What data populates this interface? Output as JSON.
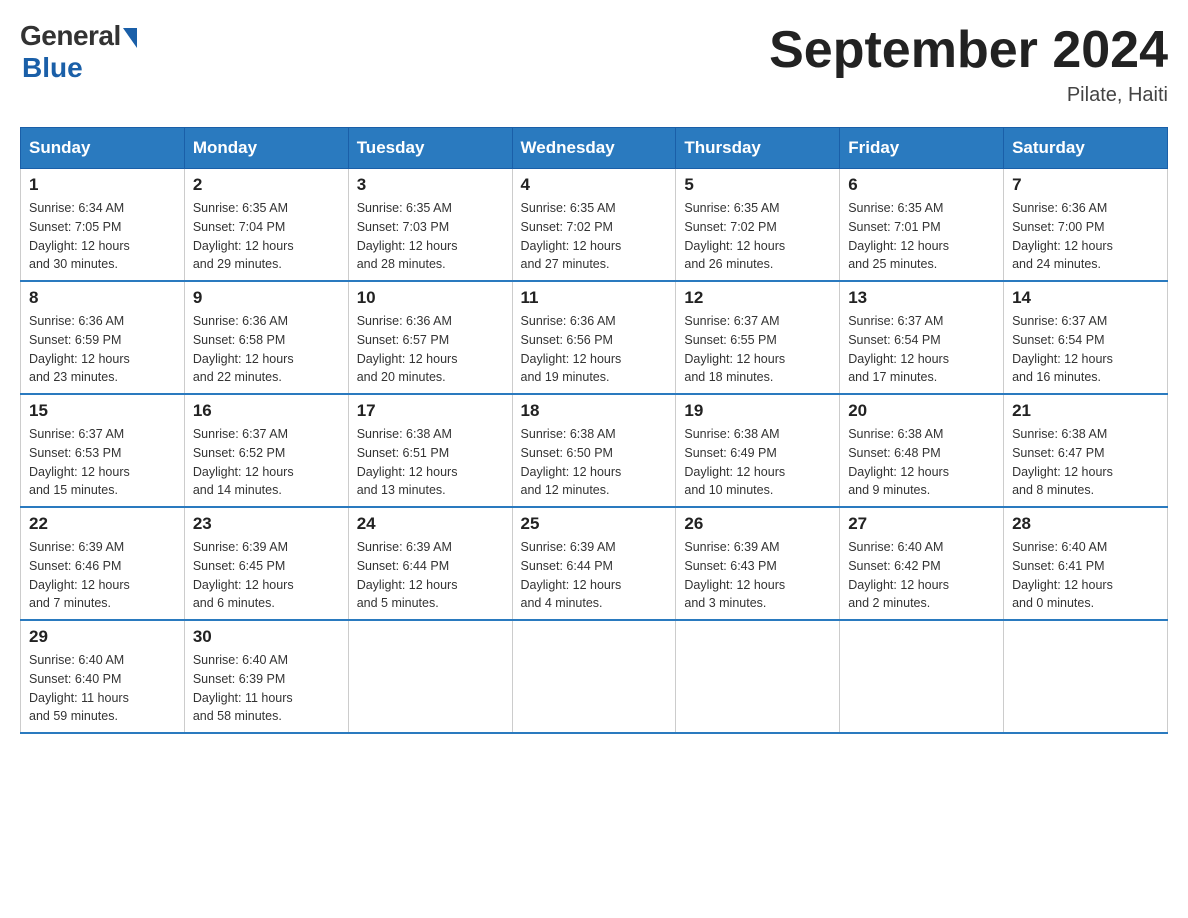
{
  "header": {
    "logo_general": "General",
    "logo_blue": "Blue",
    "month_title": "September 2024",
    "location": "Pilate, Haiti"
  },
  "weekdays": [
    "Sunday",
    "Monday",
    "Tuesday",
    "Wednesday",
    "Thursday",
    "Friday",
    "Saturday"
  ],
  "weeks": [
    [
      {
        "day": "1",
        "sunrise": "6:34 AM",
        "sunset": "7:05 PM",
        "daylight": "12 hours and 30 minutes."
      },
      {
        "day": "2",
        "sunrise": "6:35 AM",
        "sunset": "7:04 PM",
        "daylight": "12 hours and 29 minutes."
      },
      {
        "day": "3",
        "sunrise": "6:35 AM",
        "sunset": "7:03 PM",
        "daylight": "12 hours and 28 minutes."
      },
      {
        "day": "4",
        "sunrise": "6:35 AM",
        "sunset": "7:02 PM",
        "daylight": "12 hours and 27 minutes."
      },
      {
        "day": "5",
        "sunrise": "6:35 AM",
        "sunset": "7:02 PM",
        "daylight": "12 hours and 26 minutes."
      },
      {
        "day": "6",
        "sunrise": "6:35 AM",
        "sunset": "7:01 PM",
        "daylight": "12 hours and 25 minutes."
      },
      {
        "day": "7",
        "sunrise": "6:36 AM",
        "sunset": "7:00 PM",
        "daylight": "12 hours and 24 minutes."
      }
    ],
    [
      {
        "day": "8",
        "sunrise": "6:36 AM",
        "sunset": "6:59 PM",
        "daylight": "12 hours and 23 minutes."
      },
      {
        "day": "9",
        "sunrise": "6:36 AM",
        "sunset": "6:58 PM",
        "daylight": "12 hours and 22 minutes."
      },
      {
        "day": "10",
        "sunrise": "6:36 AM",
        "sunset": "6:57 PM",
        "daylight": "12 hours and 20 minutes."
      },
      {
        "day": "11",
        "sunrise": "6:36 AM",
        "sunset": "6:56 PM",
        "daylight": "12 hours and 19 minutes."
      },
      {
        "day": "12",
        "sunrise": "6:37 AM",
        "sunset": "6:55 PM",
        "daylight": "12 hours and 18 minutes."
      },
      {
        "day": "13",
        "sunrise": "6:37 AM",
        "sunset": "6:54 PM",
        "daylight": "12 hours and 17 minutes."
      },
      {
        "day": "14",
        "sunrise": "6:37 AM",
        "sunset": "6:54 PM",
        "daylight": "12 hours and 16 minutes."
      }
    ],
    [
      {
        "day": "15",
        "sunrise": "6:37 AM",
        "sunset": "6:53 PM",
        "daylight": "12 hours and 15 minutes."
      },
      {
        "day": "16",
        "sunrise": "6:37 AM",
        "sunset": "6:52 PM",
        "daylight": "12 hours and 14 minutes."
      },
      {
        "day": "17",
        "sunrise": "6:38 AM",
        "sunset": "6:51 PM",
        "daylight": "12 hours and 13 minutes."
      },
      {
        "day": "18",
        "sunrise": "6:38 AM",
        "sunset": "6:50 PM",
        "daylight": "12 hours and 12 minutes."
      },
      {
        "day": "19",
        "sunrise": "6:38 AM",
        "sunset": "6:49 PM",
        "daylight": "12 hours and 10 minutes."
      },
      {
        "day": "20",
        "sunrise": "6:38 AM",
        "sunset": "6:48 PM",
        "daylight": "12 hours and 9 minutes."
      },
      {
        "day": "21",
        "sunrise": "6:38 AM",
        "sunset": "6:47 PM",
        "daylight": "12 hours and 8 minutes."
      }
    ],
    [
      {
        "day": "22",
        "sunrise": "6:39 AM",
        "sunset": "6:46 PM",
        "daylight": "12 hours and 7 minutes."
      },
      {
        "day": "23",
        "sunrise": "6:39 AM",
        "sunset": "6:45 PM",
        "daylight": "12 hours and 6 minutes."
      },
      {
        "day": "24",
        "sunrise": "6:39 AM",
        "sunset": "6:44 PM",
        "daylight": "12 hours and 5 minutes."
      },
      {
        "day": "25",
        "sunrise": "6:39 AM",
        "sunset": "6:44 PM",
        "daylight": "12 hours and 4 minutes."
      },
      {
        "day": "26",
        "sunrise": "6:39 AM",
        "sunset": "6:43 PM",
        "daylight": "12 hours and 3 minutes."
      },
      {
        "day": "27",
        "sunrise": "6:40 AM",
        "sunset": "6:42 PM",
        "daylight": "12 hours and 2 minutes."
      },
      {
        "day": "28",
        "sunrise": "6:40 AM",
        "sunset": "6:41 PM",
        "daylight": "12 hours and 0 minutes."
      }
    ],
    [
      {
        "day": "29",
        "sunrise": "6:40 AM",
        "sunset": "6:40 PM",
        "daylight": "11 hours and 59 minutes."
      },
      {
        "day": "30",
        "sunrise": "6:40 AM",
        "sunset": "6:39 PM",
        "daylight": "11 hours and 58 minutes."
      },
      null,
      null,
      null,
      null,
      null
    ]
  ],
  "labels": {
    "sunrise": "Sunrise:",
    "sunset": "Sunset:",
    "daylight": "Daylight:"
  }
}
